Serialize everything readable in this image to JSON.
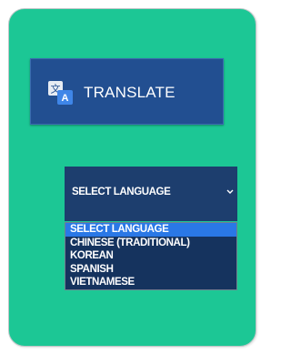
{
  "colors": {
    "panel": "#1cc795",
    "button": "#224f91",
    "select": "#1d3e6e",
    "dropdown": "#15335e",
    "highlight": "#2a78e6"
  },
  "translate": {
    "label": "TRANSLATE",
    "icon": "translate-icon"
  },
  "language_select": {
    "value": "SELECT LANGUAGE",
    "icon": "chevron-down-icon",
    "options": [
      "SELECT LANGUAGE",
      "CHINESE (TRADITIONAL)",
      "KOREAN",
      "SPANISH",
      "VIETNAMESE"
    ],
    "highlighted_index": 0
  }
}
